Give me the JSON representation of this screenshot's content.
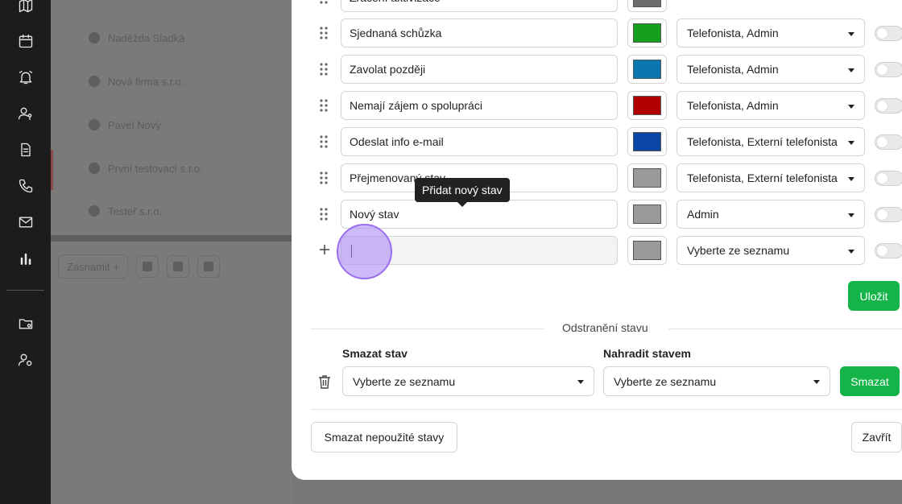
{
  "background": {
    "rows": [
      "Naděžda Sladká",
      "Nová firma s.r.o.",
      "Pavel Nový",
      "První testovací s.r.o.",
      "Testeř s.r.o."
    ],
    "toolbar_label": "Zasnamit"
  },
  "states": {
    "rows": [
      {
        "name": "Sjednaná schůzka",
        "color": "#14a01e",
        "roles": "Telefonista, Admin"
      },
      {
        "name": "Zavolat později",
        "color": "#0c76b0",
        "roles": "Telefonista, Admin"
      },
      {
        "name": "Nemají zájem o spolupráci",
        "color": "#b20000",
        "roles": "Telefonista, Admin"
      },
      {
        "name": "Odeslat info e-mail",
        "color": "#0a47a4",
        "roles": "Telefonista, Externí telefonista"
      },
      {
        "name": "Přejmenovaný stav",
        "color": "#9a9a9a",
        "roles": "Telefonista, Externí telefonista"
      },
      {
        "name": "Nový stav",
        "color": "#9a9a9a",
        "roles": "Admin"
      }
    ],
    "top_partial": {
      "name": "Zračení aktivizace",
      "color": "#6e6e6e",
      "roles": ""
    },
    "new_row": {
      "value": "",
      "color": "#9a9a9a",
      "roles_placeholder": "Vyberte ze seznamu"
    },
    "tooltip": "Přidat nový stav",
    "save_label": "Uložit"
  },
  "removal": {
    "section_title": "Odstranění stavu",
    "delete_label": "Smazat stav",
    "replace_label": "Nahradit stavem",
    "delete_select": "Vyberte ze seznamu",
    "replace_select": "Vyberte ze seznamu",
    "delete_button": "Smazat"
  },
  "footer": {
    "delete_unused": "Smazat nepoužité stavy",
    "close": "Zavřít"
  }
}
